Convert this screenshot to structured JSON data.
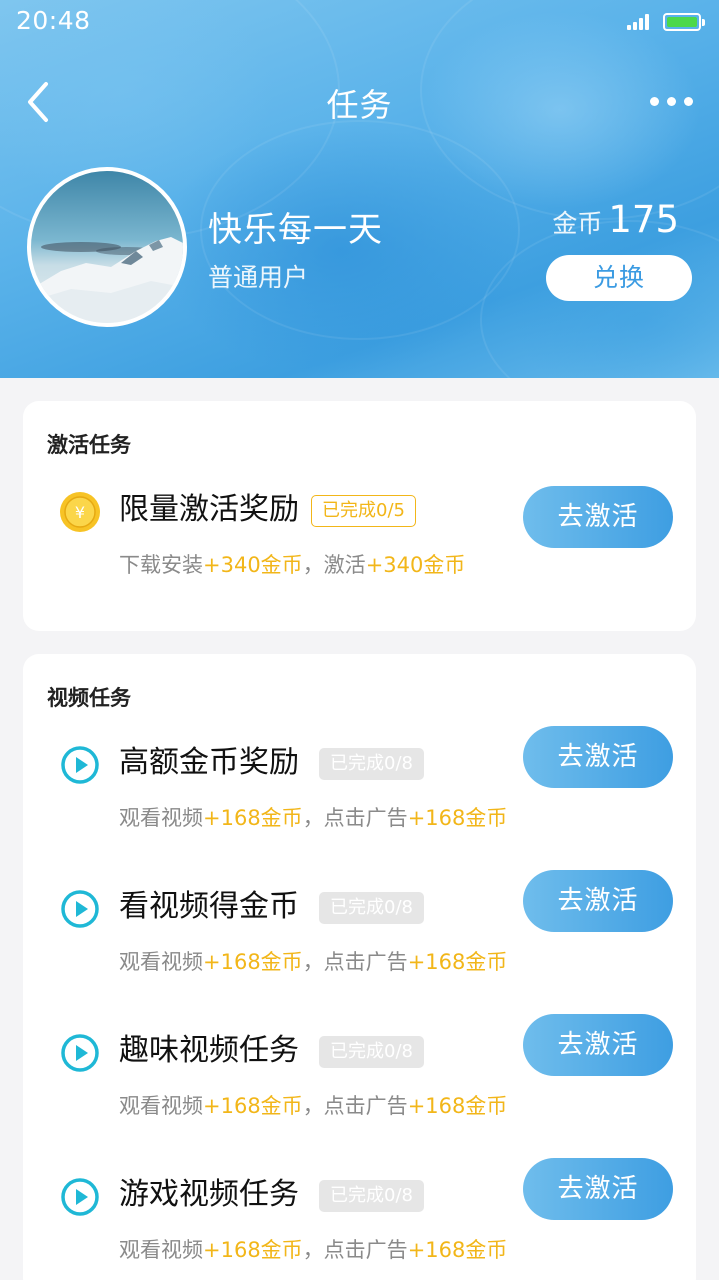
{
  "status": {
    "time": "20:48"
  },
  "header": {
    "title": "任务"
  },
  "profile": {
    "name": "快乐每一天",
    "type": "普通用户",
    "coins_label": "金币",
    "coins_value": "175",
    "exchange_label": "兑换"
  },
  "activation": {
    "title": "激活任务",
    "tasks": [
      {
        "name": "限量激活奖励",
        "badge": "已完成0/5",
        "desc_a": "下载安装",
        "desc_b": "+340金币",
        "desc_c": "，激活",
        "desc_d": "+340金币",
        "button": "去激活"
      }
    ]
  },
  "video": {
    "title": "视频任务",
    "tasks": [
      {
        "name": "高额金币奖励",
        "badge": "已完成0/8",
        "desc_a": "观看视频",
        "desc_b": "+168金币",
        "desc_c": "，点击广告",
        "desc_d": "+168金币",
        "button": "去激活"
      },
      {
        "name": "看视频得金币",
        "badge": "已完成0/8",
        "desc_a": "观看视频",
        "desc_b": "+168金币",
        "desc_c": "，点击广告",
        "desc_d": "+168金币",
        "button": "去激活"
      },
      {
        "name": "趣味视频任务",
        "badge": "已完成0/8",
        "desc_a": "观看视频",
        "desc_b": "+168金币",
        "desc_c": "，点击广告",
        "desc_d": "+168金币",
        "button": "去激活"
      },
      {
        "name": "游戏视频任务",
        "badge": "已完成0/8",
        "desc_a": "观看视频",
        "desc_b": "+168金币",
        "desc_c": "，点击广告",
        "desc_d": "+168金币",
        "button": "去激活"
      }
    ]
  },
  "icons": {
    "back": "chevron-left-icon",
    "more": "more-dots-icon",
    "coin": "yuan-coin-icon",
    "play": "play-circle-icon",
    "signal": "signal-icon",
    "battery": "battery-icon"
  },
  "colors": {
    "accent": "#3e9ee2",
    "highlight": "#f2b619",
    "play_icon": "#1fb8d6",
    "battery_fill": "#4cd84a"
  }
}
